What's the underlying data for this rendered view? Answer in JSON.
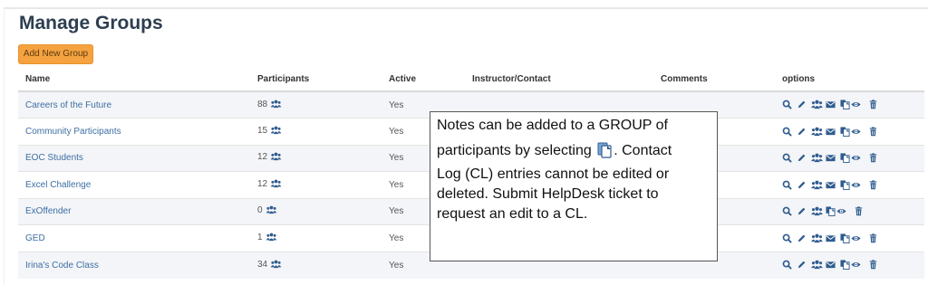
{
  "page": {
    "title": "Manage Groups",
    "add_button": "Add New Group"
  },
  "table": {
    "headers": {
      "name": "Name",
      "participants": "Participants",
      "active": "Active",
      "instructor": "Instructor/Contact",
      "comments": "Comments",
      "options": "options"
    },
    "rows": [
      {
        "name": "Careers of the Future",
        "participants": "88",
        "active": "Yes",
        "has_email": true
      },
      {
        "name": "Community Participants",
        "participants": "15",
        "active": "Yes",
        "has_email": true
      },
      {
        "name": "EOC Students",
        "participants": "12",
        "active": "Yes",
        "has_email": true
      },
      {
        "name": "Excel Challenge",
        "participants": "12",
        "active": "Yes",
        "has_email": true
      },
      {
        "name": "ExOffender",
        "participants": "0",
        "active": "Yes",
        "has_email": false
      },
      {
        "name": "GED",
        "participants": "1",
        "active": "Yes",
        "has_email": true
      },
      {
        "name": "Irina's Code Class",
        "participants": "34",
        "active": "Yes",
        "has_email": true
      }
    ]
  },
  "callout": {
    "line1": "Notes can be added to a GROUP of",
    "line2_before": "participants by selecting",
    "line2_after": ". Contact",
    "line3": "Log (CL) entries cannot be edited or",
    "line4": "deleted. Submit HelpDesk ticket to",
    "line5": "request an edit to a CL."
  },
  "colors": {
    "accent": "#f5a340",
    "link": "#3d6fa3",
    "icon": "#2f5c8f",
    "title": "#2d3e50"
  },
  "icons": [
    "search-icon",
    "edit-icon",
    "group-icon",
    "email-icon",
    "notes-icon",
    "view-icon",
    "trash-icon"
  ]
}
